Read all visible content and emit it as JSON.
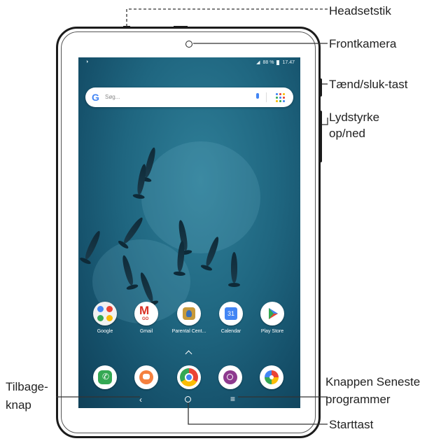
{
  "status_bar": {
    "battery": "88 %",
    "time": "17.47"
  },
  "search": {
    "placeholder": "Søg..."
  },
  "apps": [
    {
      "label": "Google",
      "icon": "google-folder-icon"
    },
    {
      "label": "Gmail",
      "icon": "gmail-icon"
    },
    {
      "label": "Parental Cent...",
      "icon": "parental-center-icon"
    },
    {
      "label": "Calendar",
      "icon": "calendar-icon",
      "day": "31"
    },
    {
      "label": "Play Store",
      "icon": "play-store-icon"
    }
  ],
  "dock": [
    {
      "icon": "phone-icon"
    },
    {
      "icon": "messages-icon"
    },
    {
      "icon": "chrome-icon"
    },
    {
      "icon": "camera-app-icon"
    },
    {
      "icon": "photos-icon"
    }
  ],
  "gmail_badge": "GO",
  "callouts": {
    "headset": "Headsetstik",
    "front_camera": "Frontkamera",
    "power_key": "Tænd/sluk-tast",
    "volume_line1": "Lydstyrke",
    "volume_line2": "op/ned",
    "back_line1": "Tilbage-",
    "back_line2": "knap",
    "recent_line1": "Knappen Seneste",
    "recent_line2": "programmer",
    "home": "Starttast"
  },
  "colors": {
    "google_blue": "#4285f4",
    "gmail_red": "#d93025",
    "phone_green": "#34a853",
    "messages_orange": "#f5803e",
    "camera_purple": "#8e3a8f",
    "sea": "#1f6680"
  }
}
